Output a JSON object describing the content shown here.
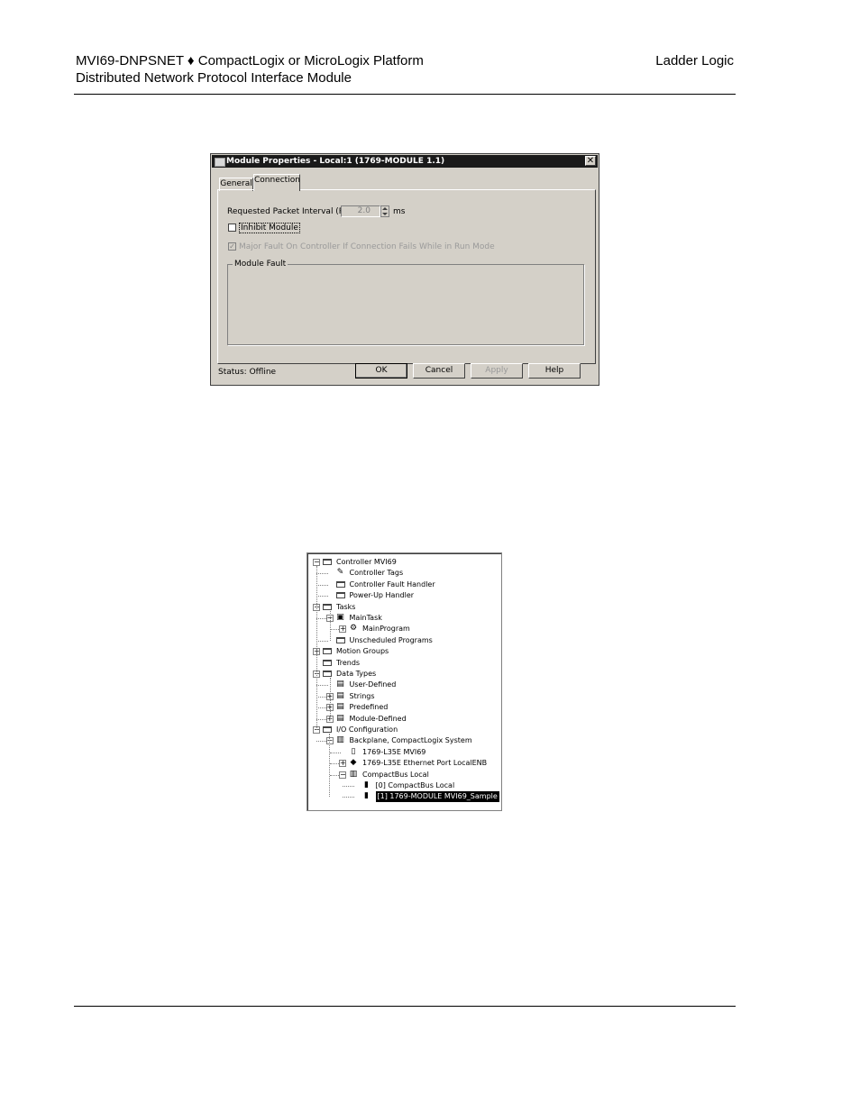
{
  "header": {
    "left_line1": "MVI69-DNPSNET ♦ CompactLogix or MicroLogix Platform",
    "left_line2": "Distributed Network Protocol Interface Module",
    "right": "Ladder Logic"
  },
  "dialog": {
    "title": "Module Properties - Local:1 (1769-MODULE 1.1)",
    "close_glyph": "✕",
    "tabs": [
      "General",
      "Connection"
    ],
    "rpi_label": "Requested Packet Interval (RPI):",
    "rpi_value": "2.0",
    "rpi_unit": "ms",
    "inhibit_label": "Inhibit Module",
    "inhibit_checked": false,
    "major_fault_label": "Major Fault On Controller If Connection Fails While in Run Mode",
    "major_fault_checked": true,
    "module_fault_group": "Module Fault",
    "status": "Status:  Offline",
    "buttons": {
      "ok": "OK",
      "cancel": "Cancel",
      "apply": "Apply",
      "help": "Help"
    }
  },
  "tree": {
    "items": [
      {
        "label": "Controller MVI69",
        "expander": "−",
        "icon": "folder-open-icon"
      },
      {
        "label": "Controller Tags",
        "icon": "tags-icon"
      },
      {
        "label": "Controller Fault Handler",
        "icon": "folder-icon"
      },
      {
        "label": "Power-Up Handler",
        "icon": "folder-icon"
      },
      {
        "label": "Tasks",
        "expander": "−",
        "icon": "folder-open-icon"
      },
      {
        "label": "MainTask",
        "expander": "−",
        "icon": "task-icon"
      },
      {
        "label": "MainProgram",
        "expander": "+",
        "icon": "program-icon"
      },
      {
        "label": "Unscheduled Programs",
        "icon": "folder-icon"
      },
      {
        "label": "Motion Groups",
        "expander": "+",
        "icon": "folder-icon"
      },
      {
        "label": "Trends",
        "icon": "folder-icon"
      },
      {
        "label": "Data Types",
        "expander": "−",
        "icon": "folder-open-icon"
      },
      {
        "label": "User-Defined",
        "icon": "datatype-icon"
      },
      {
        "label": "Strings",
        "expander": "+",
        "icon": "datatype-icon"
      },
      {
        "label": "Predefined",
        "expander": "+",
        "icon": "datatype-icon"
      },
      {
        "label": "Module-Defined",
        "expander": "+",
        "icon": "datatype-icon"
      },
      {
        "label": "I/O Configuration",
        "expander": "−",
        "icon": "folder-open-icon"
      },
      {
        "label": "Backplane, CompactLogix System",
        "expander": "−",
        "icon": "backplane-icon"
      },
      {
        "label": "1769-L35E MVI69",
        "icon": "controller-icon"
      },
      {
        "label": "1769-L35E Ethernet Port LocalENB",
        "expander": "+",
        "icon": "ethernet-icon"
      },
      {
        "label": "CompactBus Local",
        "expander": "−",
        "icon": "bus-icon"
      },
      {
        "label": "[0] CompactBus Local",
        "icon": "module-icon"
      },
      {
        "label": "[1] 1769-MODULE MVI69_Sample",
        "icon": "module-icon",
        "selected": true
      }
    ]
  }
}
